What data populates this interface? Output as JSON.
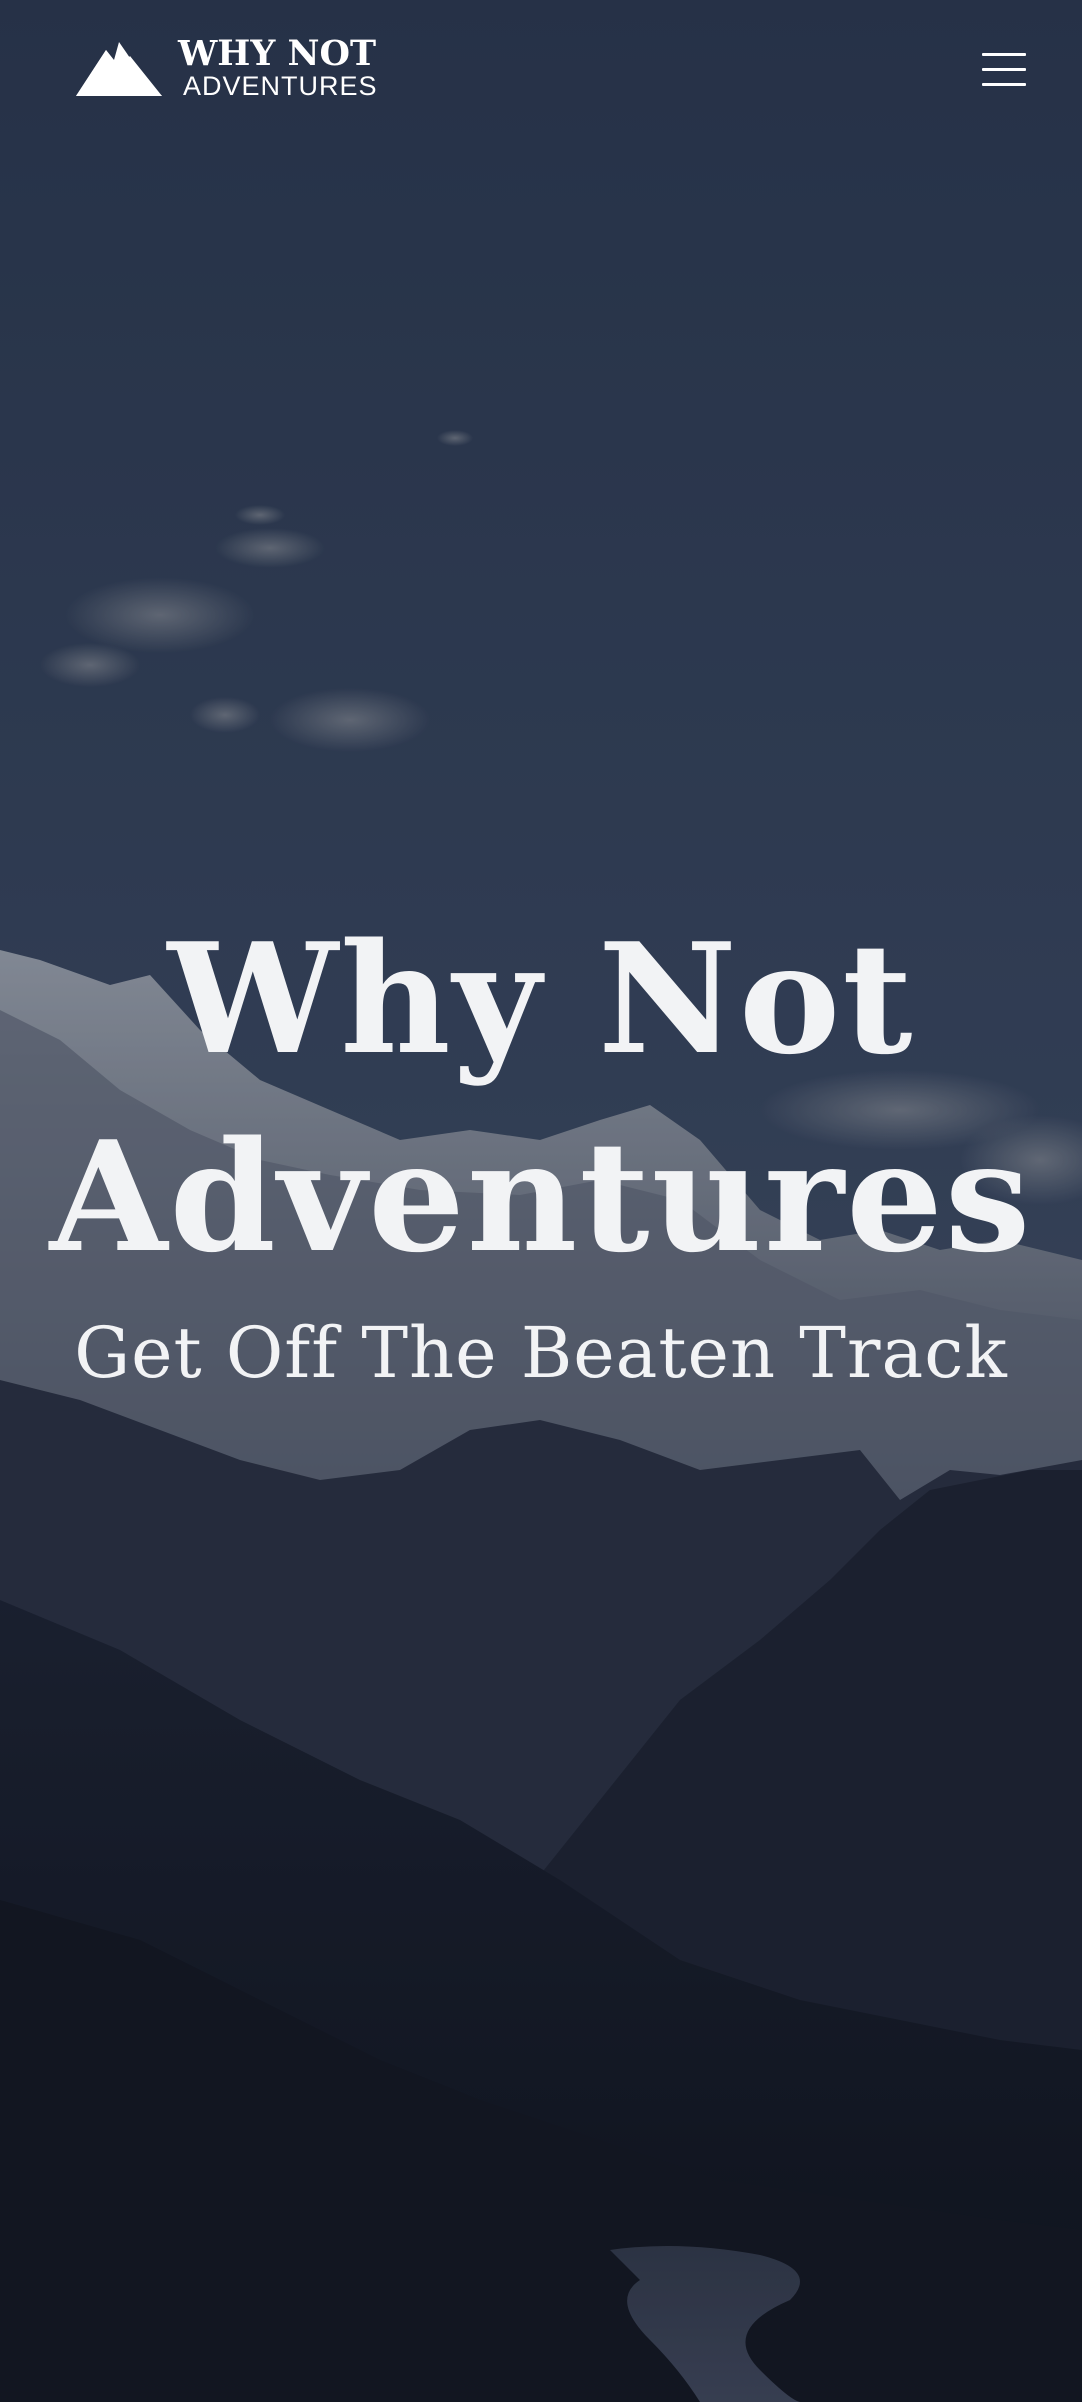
{
  "header": {
    "logo": {
      "icon": "mountain-logo-icon",
      "line1": "WHY NOT",
      "line2": "ADVENTURES"
    },
    "menu": {
      "icon": "hamburger-menu-icon"
    }
  },
  "hero": {
    "title_line1": "Why Not",
    "title_line2": "Adventures",
    "subtitle": "Get Off The Beaten Track",
    "background": "mountain-landscape-photo"
  },
  "colors": {
    "sky_top": "#2c3a54",
    "sky_mid": "#3a4862",
    "text": "#f2f3f5",
    "dark_ground": "#121622"
  }
}
